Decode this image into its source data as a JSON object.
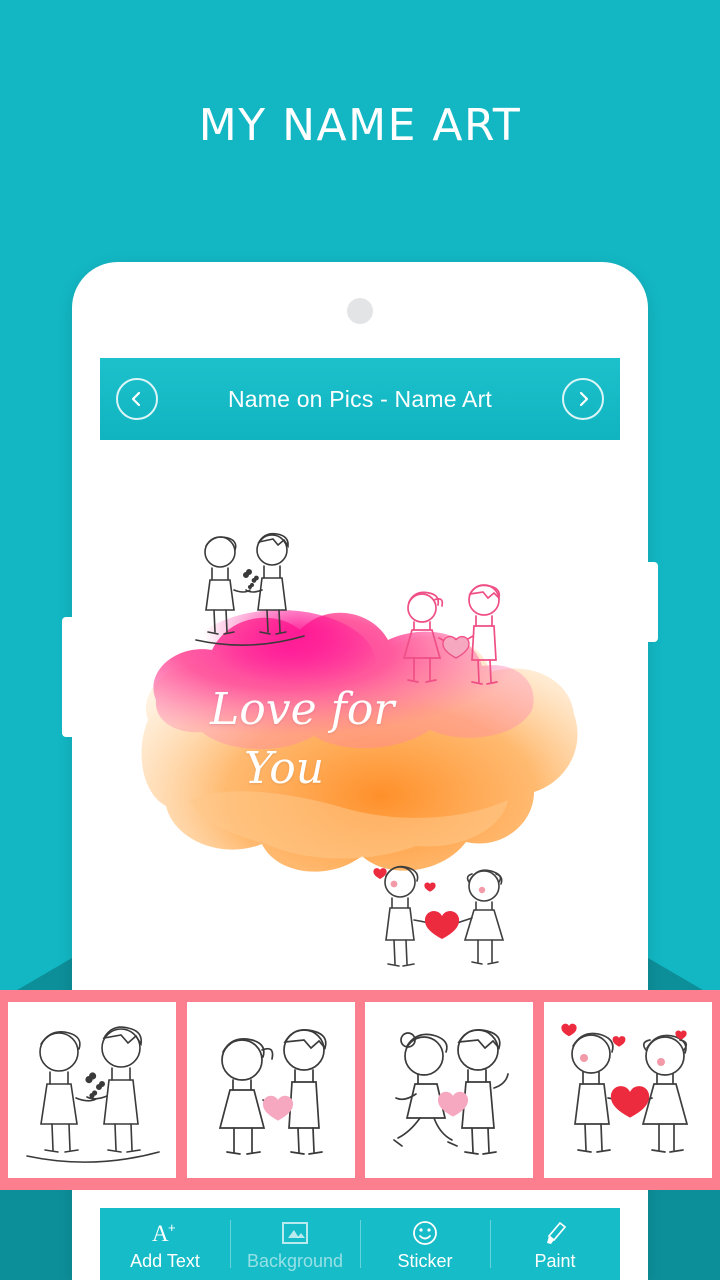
{
  "page": {
    "title": "MY NAME ART",
    "background_color": "#13b7c4",
    "wedge_color": "#0d8f99"
  },
  "app": {
    "appbar": {
      "title": "Name on Pics - Name Art",
      "prev_icon": "chevron-left-icon",
      "next_icon": "chevron-right-icon",
      "background_color": "#16bcc7"
    },
    "canvas": {
      "art_line1": "Love for",
      "art_line2": "You",
      "doodles": [
        "couple-doodle-blowing-kisses",
        "couple-doodle-holding-hands-pink",
        "couple-doodle-holding-heart"
      ]
    },
    "sticker_strip": {
      "background_color": "#fc7f8f",
      "items": [
        {
          "name": "sticker-couple-kisses"
        },
        {
          "name": "sticker-couple-holding-hands"
        },
        {
          "name": "sticker-couple-jumping-kiss"
        },
        {
          "name": "sticker-couple-heart"
        }
      ]
    },
    "toolbar": {
      "background_color": "#16bcc7",
      "items": [
        {
          "label": "Add Text",
          "icon": "add-text-icon",
          "state": "active"
        },
        {
          "label": "Background",
          "icon": "background-icon",
          "state": "dim"
        },
        {
          "label": "Sticker",
          "icon": "smiley-sticker-icon",
          "state": "active"
        },
        {
          "label": "Paint",
          "icon": "paint-brush-icon",
          "state": "active"
        }
      ]
    }
  }
}
